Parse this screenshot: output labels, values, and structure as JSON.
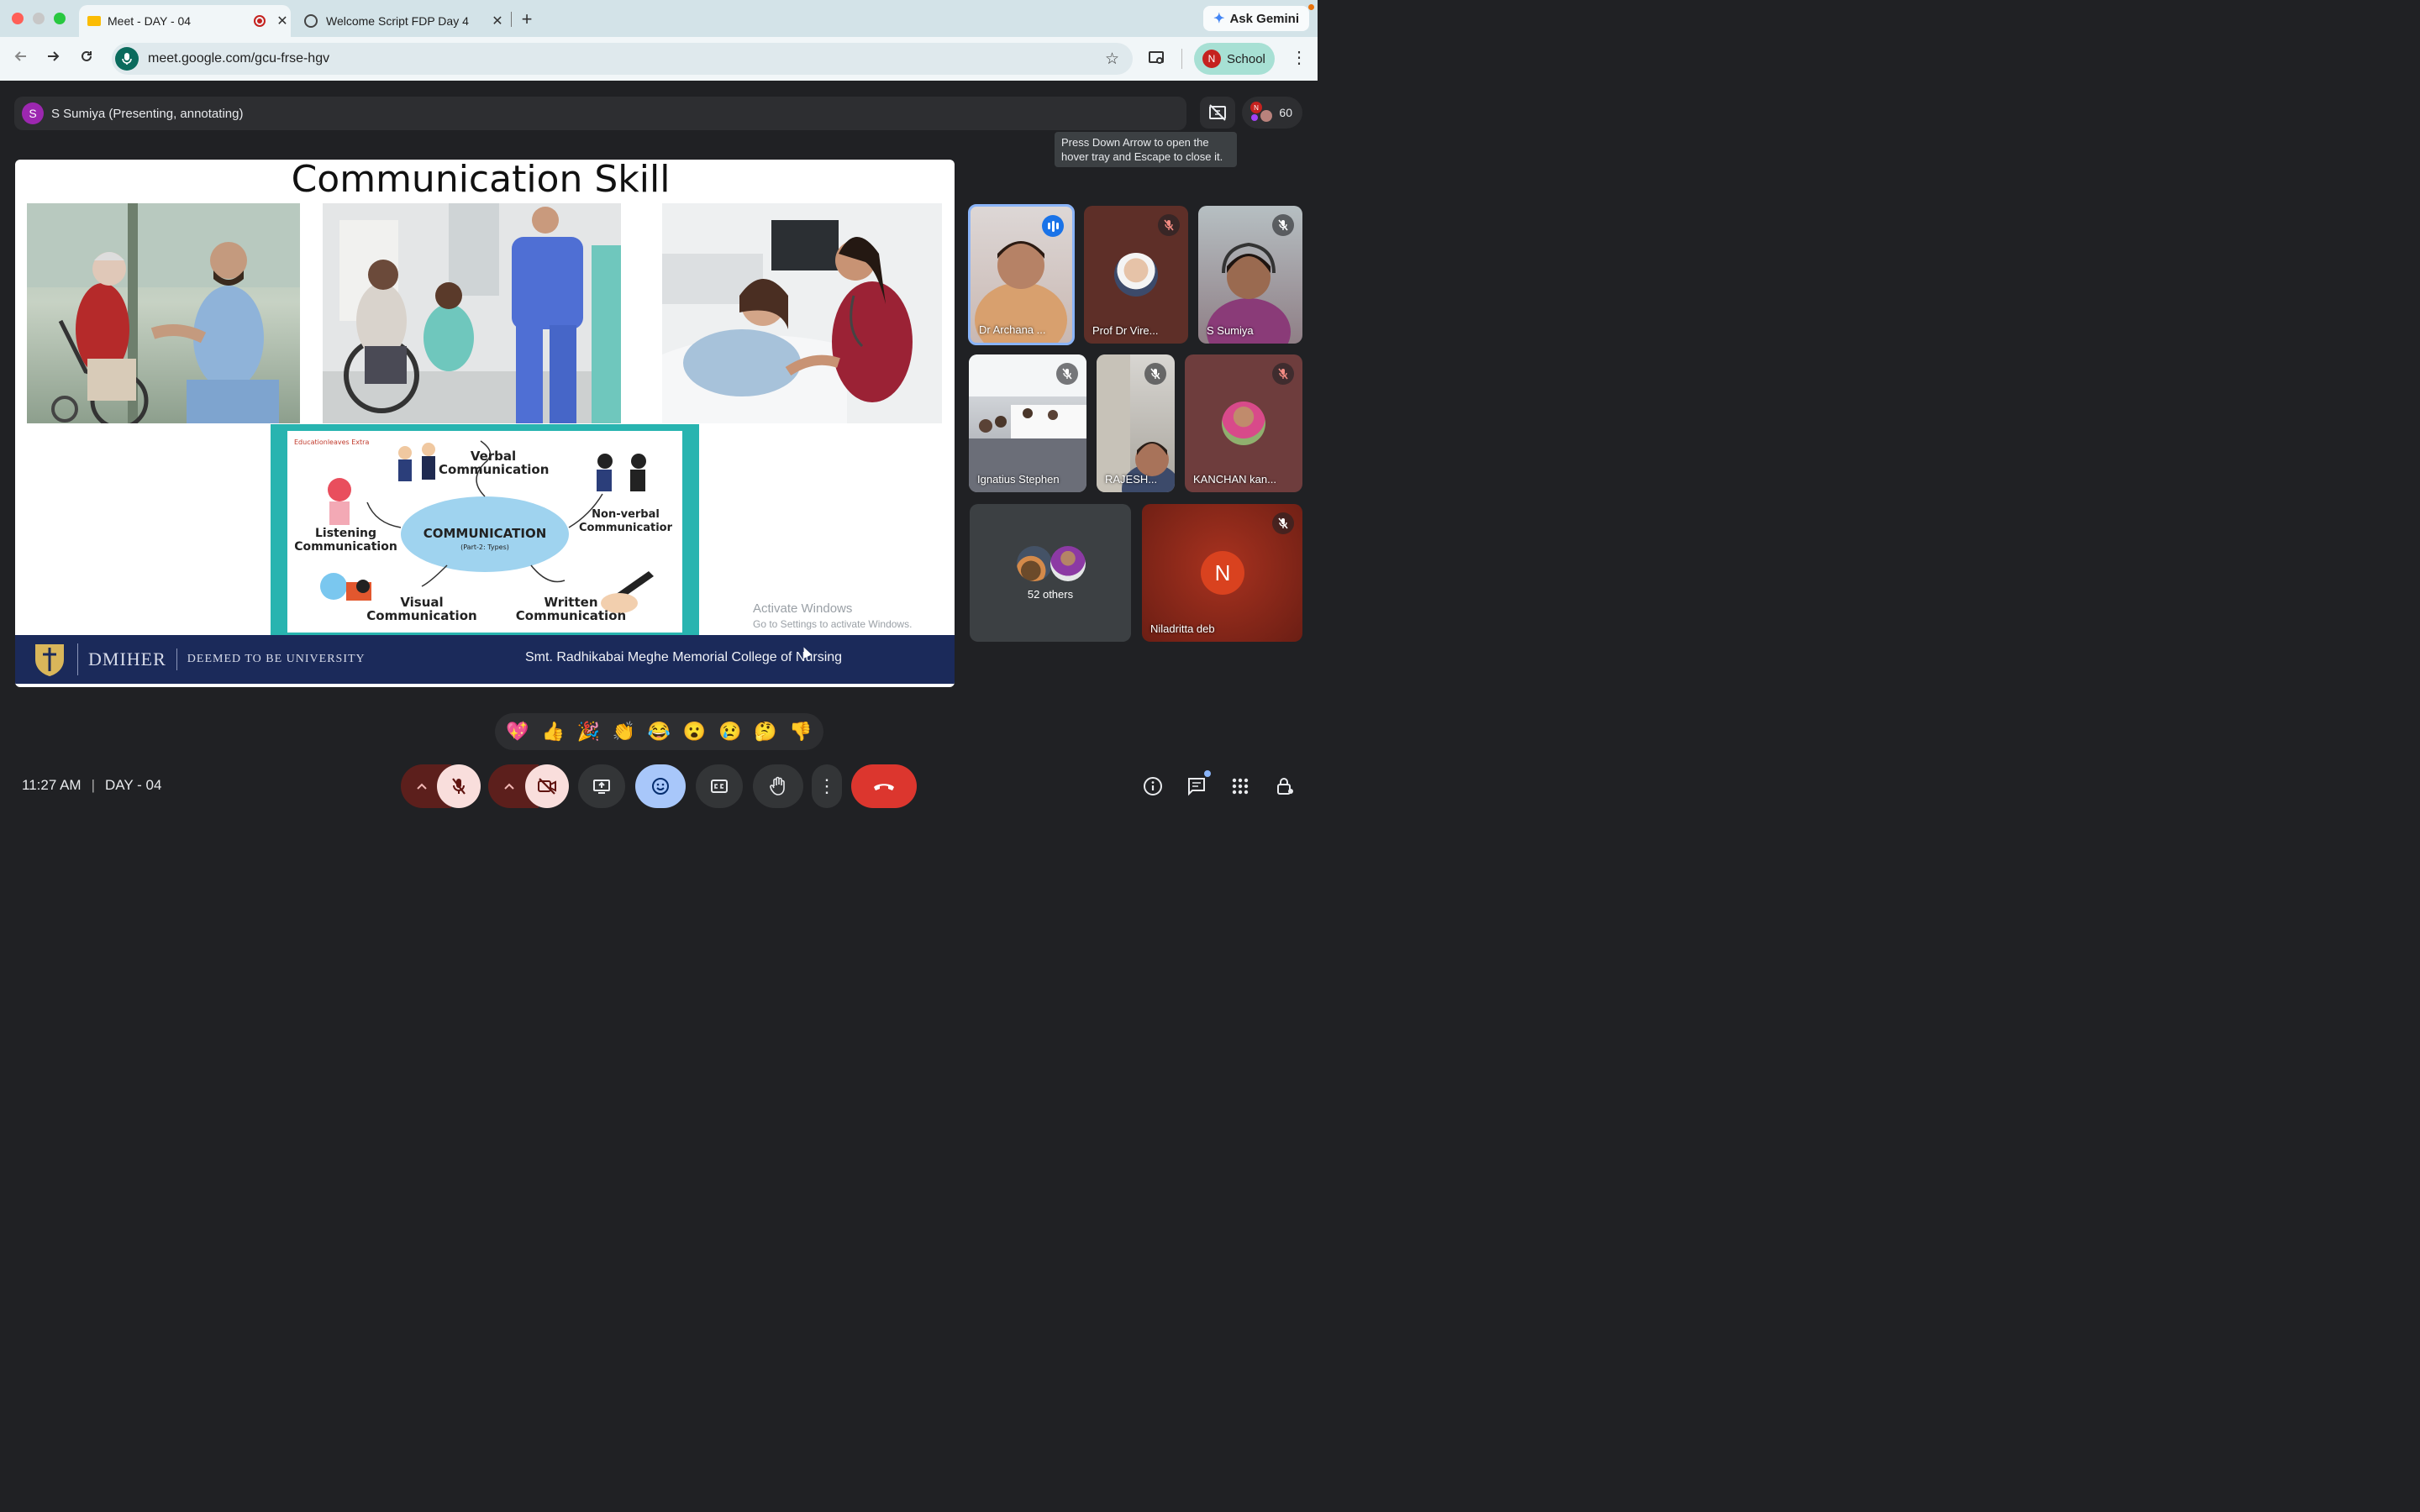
{
  "browser": {
    "tabs": [
      {
        "title": "Meet - DAY - 04",
        "active": true
      },
      {
        "title": "Welcome Script FDP Day 4",
        "active": false
      }
    ],
    "gemini_label": "Ask Gemini",
    "url": "meet.google.com/gcu-frse-hgv",
    "profile_initial": "N",
    "profile_label": "School"
  },
  "meet": {
    "presenter_initial": "S",
    "presenter_label": "S Sumiya (Presenting, annotating)",
    "participant_count": "60",
    "tooltip": "Press Down Arrow to open the hover tray and Escape to close it."
  },
  "slide": {
    "title": "Communication Skill",
    "diagram": {
      "watermark": "Educationleaves Extra",
      "center": "COMMUNICATION",
      "center_sub": "(Part-2: Types)",
      "verbal": "Verbal Communication",
      "nonverbal": "Non-verbal Communicatior",
      "listening": "Listening Communication",
      "visual": "Visual Communication",
      "written": "Written Communication"
    },
    "footer_brand": "DMIHER",
    "footer_sub": "DEEMED TO BE UNIVERSITY",
    "footer_college": "Smt. Radhikabai Meghe Memorial College of Nursing",
    "activate_title": "Activate Windows",
    "activate_sub": "Go to Settings to activate Windows."
  },
  "participants": [
    {
      "name": "Dr Archana ..."
    },
    {
      "name": "Prof Dr Vire..."
    },
    {
      "name": "S Sumiya"
    },
    {
      "name": "Ignatius Stephen"
    },
    {
      "name": "RAJESH..."
    },
    {
      "name": "KANCHAN kan..."
    },
    {
      "name": "52 others"
    },
    {
      "name": "Niladritta deb",
      "initial": "N"
    }
  ],
  "reactions": [
    "💖",
    "👍",
    "🎉",
    "👏",
    "😂",
    "😮",
    "😢",
    "🤔",
    "👎"
  ],
  "bottom": {
    "time": "11:27 AM",
    "meeting_name": "DAY - 04"
  },
  "colors": {
    "accent_blue": "#8ab4f8",
    "hangup_red": "#dc362e",
    "muted_red_bg": "#f9dedc",
    "profile_green": "#a7e0d4",
    "slide_footer": "#1b2a5a"
  }
}
